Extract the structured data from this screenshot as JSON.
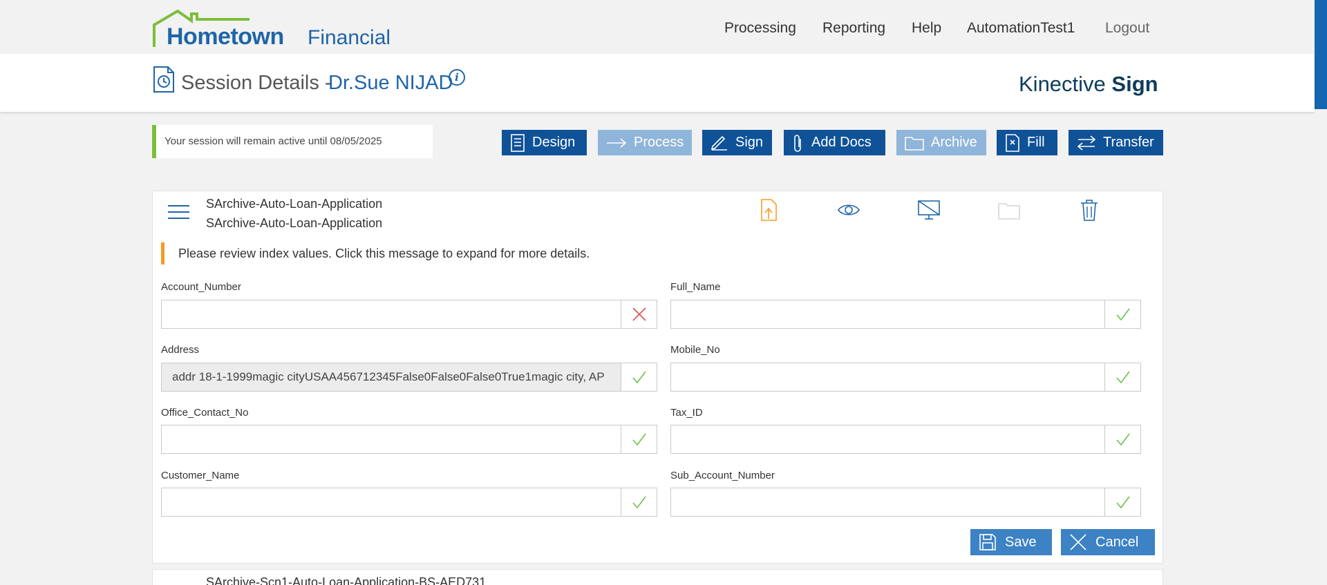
{
  "brand": {
    "name_primary": "Hometown",
    "name_secondary": "Financial"
  },
  "nav": {
    "processing": "Processing",
    "reporting": "Reporting",
    "help": "Help",
    "user": "AutomationTest1",
    "logout": "Logout"
  },
  "header": {
    "title": "Session Details -",
    "name": "Dr.Sue NIJAD",
    "info": "i",
    "product_a": "Kinective",
    "product_b": "Sign"
  },
  "session_notice": "Your session will remain active until 08/05/2025",
  "toolbar": {
    "design": "Design",
    "process": "Process",
    "sign": "Sign",
    "add_docs": "Add Docs",
    "archive": "Archive",
    "fill": "Fill",
    "transfer": "Transfer"
  },
  "document": {
    "title_line1": "SArchive-Auto-Loan-Application",
    "title_line2": "SArchive-Auto-Loan-Application",
    "warning": "Please review index values. Click this message to expand for more details.",
    "fields": {
      "account_number": {
        "label": "Account_Number",
        "value": "",
        "status": "invalid"
      },
      "full_name": {
        "label": "Full_Name",
        "value": "",
        "status": "valid"
      },
      "address": {
        "label": "Address",
        "value": "addr 18-1-1999magic cityUSAA456712345False0False0False0True1magic city, AP",
        "status": "valid"
      },
      "mobile_no": {
        "label": "Mobile_No",
        "value": "",
        "status": "valid"
      },
      "office_contact_no": {
        "label": "Office_Contact_No",
        "value": "",
        "status": "valid"
      },
      "tax_id": {
        "label": "Tax_ID",
        "value": "",
        "status": "valid"
      },
      "customer_name": {
        "label": "Customer_Name",
        "value": "",
        "status": "valid"
      },
      "sub_account_number": {
        "label": "Sub_Account_Number",
        "value": "",
        "status": "valid"
      }
    },
    "save": "Save",
    "cancel": "Cancel"
  },
  "next_document": {
    "title": "SArchive-Scn1-Auto-Loan-Application-BS-AED731"
  },
  "colors": {
    "brand_blue": "#1f65a8",
    "toolbar_blue": "#0f5298",
    "toolbar_disabled": "#8fb5da",
    "notice_green": "#7cbe3b",
    "warning_orange": "#f39c28",
    "valid_green": "#6cc04a",
    "invalid_red": "#d9534f"
  }
}
